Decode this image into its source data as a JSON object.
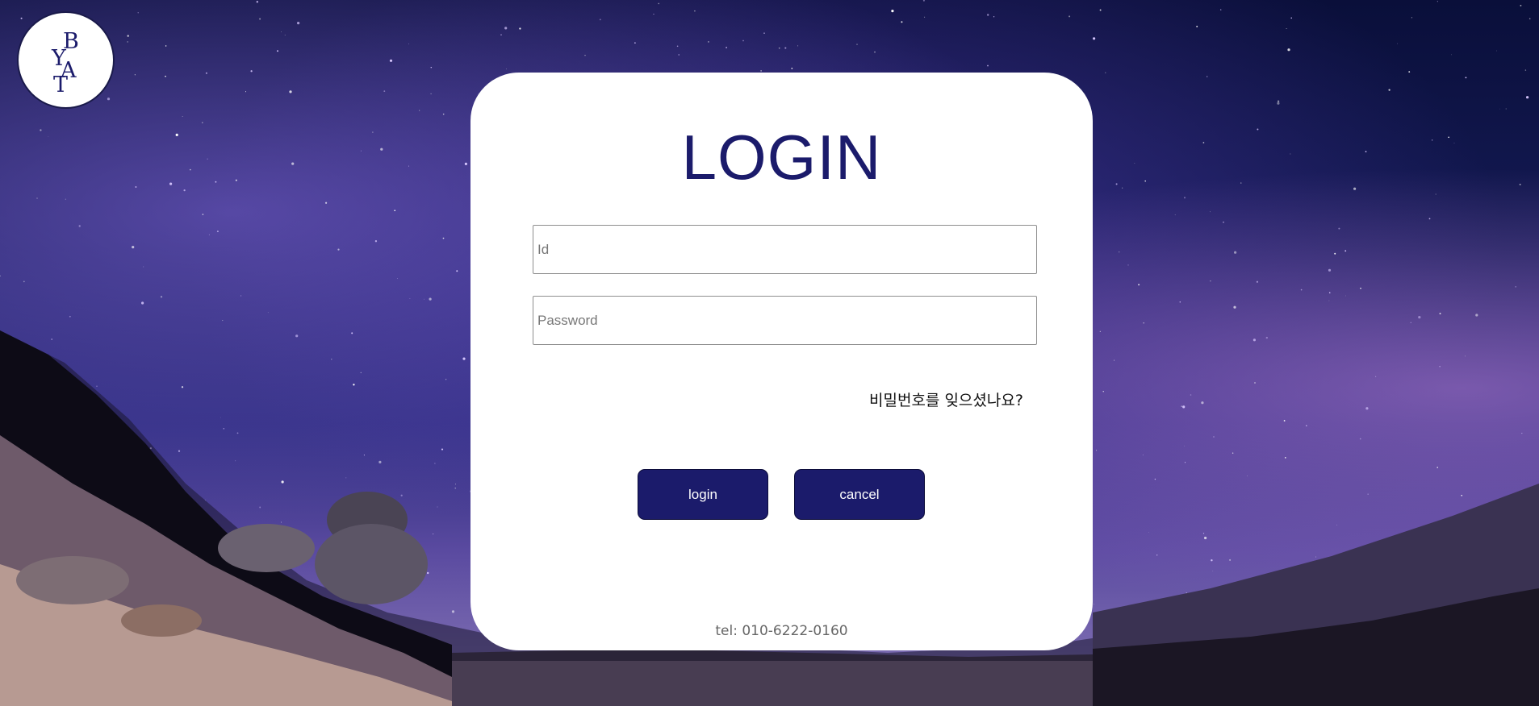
{
  "logo": {
    "letters": [
      "B",
      "Y",
      "A",
      "T"
    ]
  },
  "login": {
    "title": "LOGIN",
    "id_placeholder": "Id",
    "password_placeholder": "Password",
    "forgot_password": "비밀번호를 잊으셨나요?",
    "login_button": "login",
    "cancel_button": "cancel",
    "tel": "tel: 010-6222-0160"
  },
  "colors": {
    "accent": "#1b1b6b",
    "card": "#ffffff",
    "sky": "#141a55"
  }
}
